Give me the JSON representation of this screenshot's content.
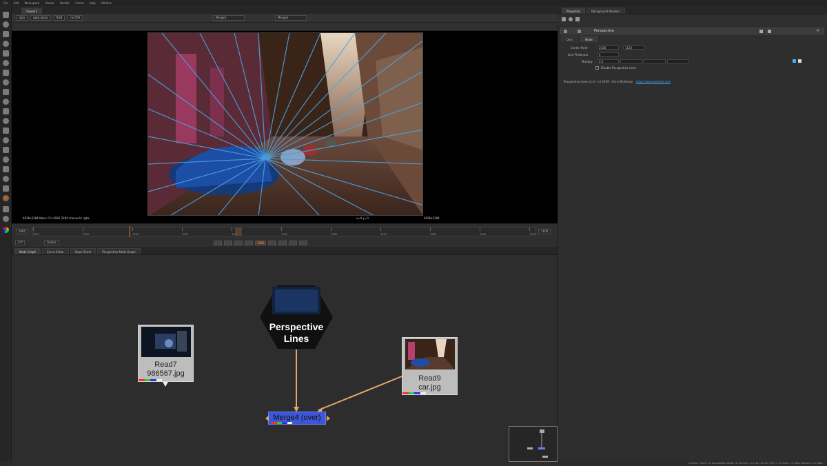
{
  "menubar": {
    "items": [
      "File",
      "Edit",
      "Workspace",
      "Viewer",
      "Render",
      "Cache",
      "Help",
      "Utilities"
    ]
  },
  "viewer": {
    "tab_label": "Viewer1",
    "channel_layer": "rgba",
    "channel_alpha": "rgba.alpha",
    "colorspace": "RGB",
    "lut": "rec709",
    "input_a": "Merge4",
    "input_b": "Merge4",
    "image_info": "4926x3284 bbox: 0 0 4926 3284 channels: rgba",
    "image_x": "x=0 y=0",
    "format": "4926x3284"
  },
  "timeline": {
    "start_frame": "1001",
    "end_frame": "1100",
    "fps_label": "24*",
    "mode": "Global",
    "ticks": [
      "1001",
      "1010",
      "1020",
      "1030",
      "1040",
      "1050",
      "1060",
      "1070",
      "1080",
      "1090",
      "1100"
    ],
    "current_frame": "1030"
  },
  "nodegraph": {
    "tabs": [
      "Node Graph",
      "Curve Editor",
      "Dope Sheet",
      "Perspective Node Graph"
    ],
    "perspective_node": {
      "line1": "Perspective",
      "line2": "Lines"
    },
    "read7": {
      "line1": "Read7",
      "line2": "986567.jpg"
    },
    "read9": {
      "line1": "Read9",
      "line2": "car.jpg"
    },
    "merge": {
      "label": "Merge4 (over)"
    }
  },
  "properties": {
    "tabs": [
      "Properties",
      "Background Renders"
    ],
    "node_title": "Perspective",
    "subtabs": [
      "User",
      "Node"
    ],
    "center_point_label": "Center Point",
    "center_x": "2038",
    "center_y": "1120",
    "line_thickness_label": "Line Thickness",
    "line_thickness": "4",
    "multiply_label": "Multiply",
    "multiply": "0.5",
    "disable_label": "Disable Perspective Lines",
    "credit": "Perspective Lines v1.0 - (c) 2019 - Chris McGowan",
    "credit_link": "https://www.website.com"
  },
  "statusbar": {
    "text": "Channel Count: 76  Localization Mode: On  Memory: 4.1 GB (13.3%)  CPU: 7.1%  Disk: 0.0 MB/s  Network: 0.0 MB/s"
  },
  "colors": {
    "merge_node": "#3d57d8",
    "pipe": "#e0a96a",
    "perspective_line": "#4aa3e0",
    "node_body": "#bdbdbd"
  }
}
